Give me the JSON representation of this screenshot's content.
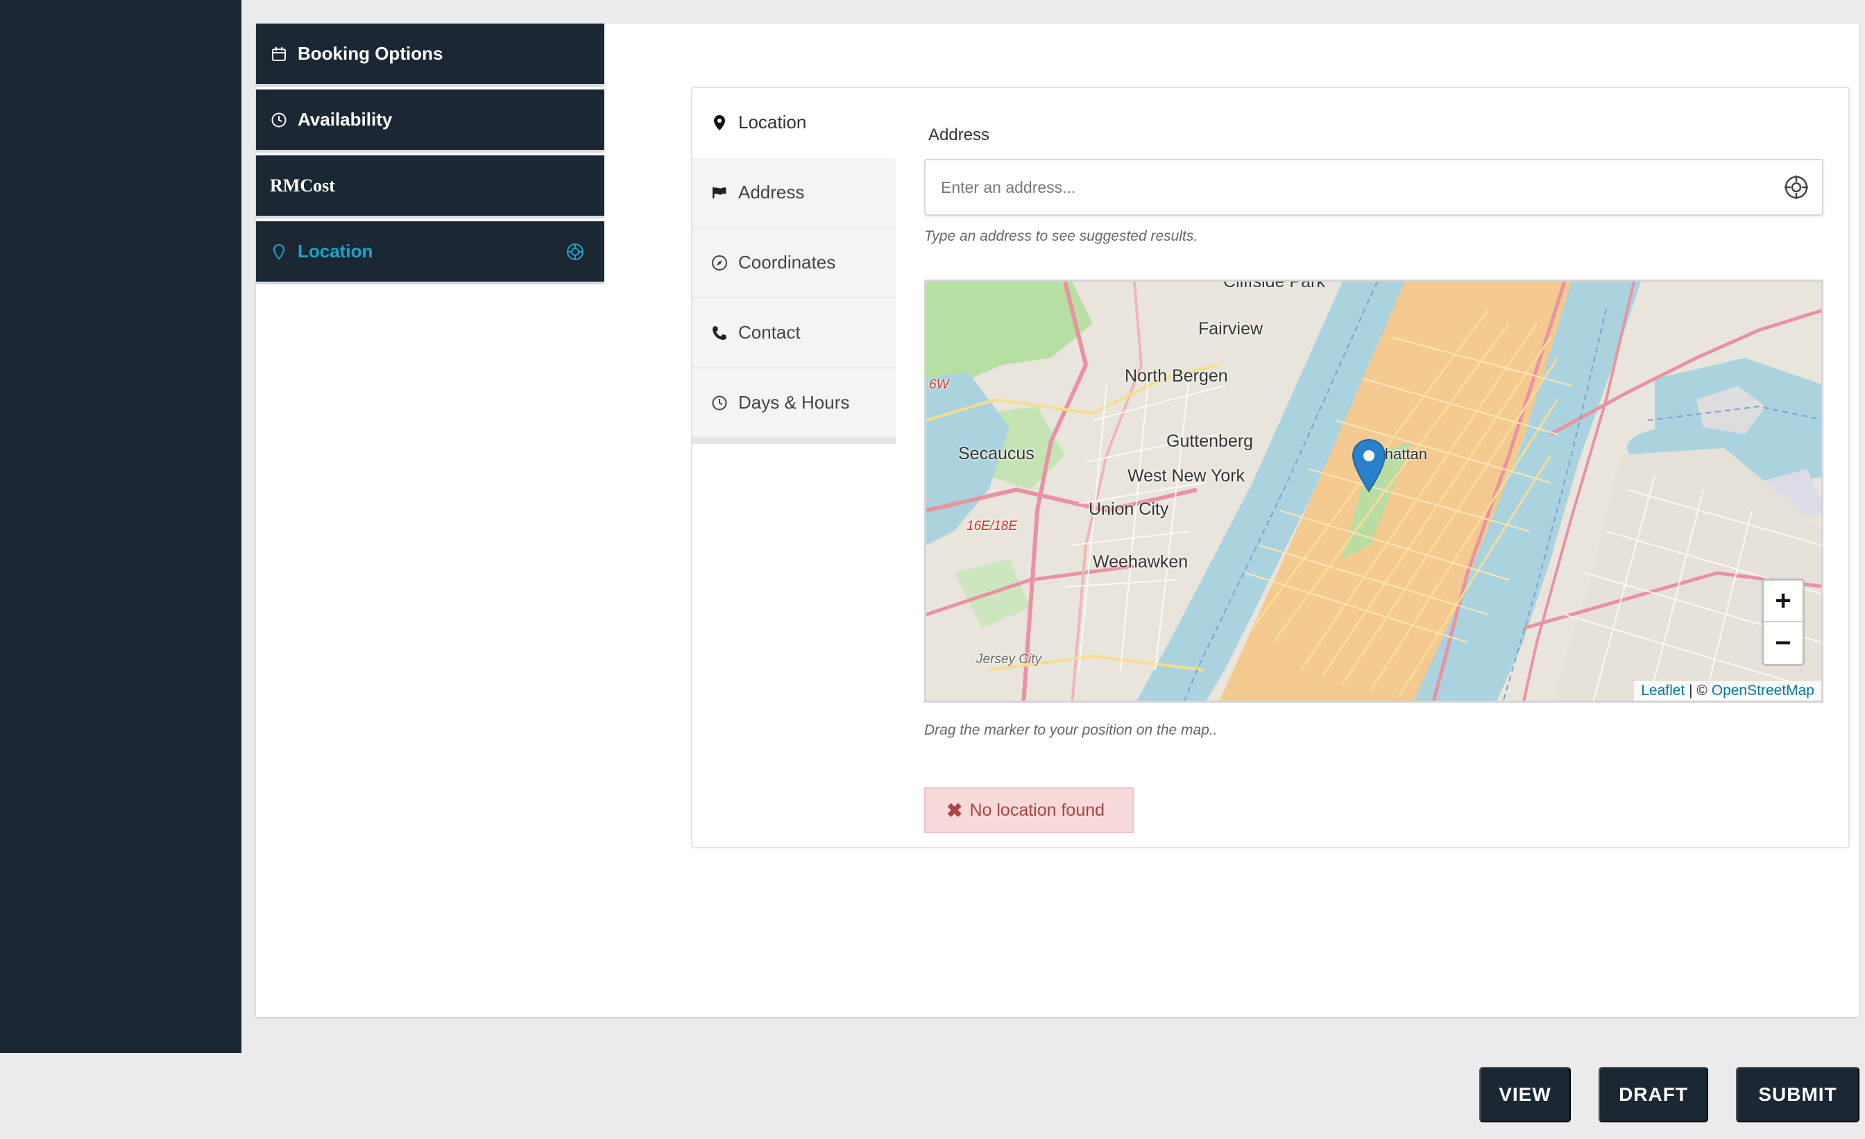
{
  "sidenav": {
    "items": [
      {
        "label": "Booking Options",
        "icon": "calendar-icon"
      },
      {
        "label": "Availability",
        "icon": "clock-icon"
      },
      {
        "label": "RMCost",
        "icon": ""
      },
      {
        "label": "Location",
        "icon": "map-pin-outline-icon",
        "trailing_icon": "crosshair-icon",
        "active": true
      }
    ]
  },
  "tabs": [
    {
      "label": "Location",
      "icon": "map-marker-icon",
      "active": true
    },
    {
      "label": "Address",
      "icon": "flag-icon"
    },
    {
      "label": "Coordinates",
      "icon": "compass-icon"
    },
    {
      "label": "Contact",
      "icon": "phone-icon"
    },
    {
      "label": "Days & Hours",
      "icon": "clock-icon"
    }
  ],
  "address": {
    "label": "Address",
    "placeholder": "Enter an address...",
    "value": "",
    "help": "Type an address to see suggested results."
  },
  "map": {
    "labels": {
      "cliffside": "Cliffside Park",
      "fairview": "Fairview",
      "north_bergen": "North Bergen",
      "secaucus": "Secaucus",
      "guttenberg": "Guttenberg",
      "west_new_york": "West New York",
      "union_city": "Union City",
      "weehawken": "Weehawken",
      "manhattan": "Manhattan",
      "jersey_city": "Jersey City",
      "route_a": "16E/18E",
      "route_b": "6W"
    },
    "zoom_in": "+",
    "zoom_out": "−",
    "attribution_leaflet": "Leaflet",
    "attribution_sep": " | © ",
    "attribution_osm": "OpenStreetMap",
    "help": "Drag the marker to your position on the map.."
  },
  "alert": {
    "icon": "✖",
    "text": "No location found"
  },
  "actions": {
    "view": "VIEW",
    "draft": "DRAFT",
    "submit": "SUBMIT"
  },
  "colors": {
    "navy": "#1b2834",
    "accent": "#1fa3c9",
    "alert_bg": "#f7d9da",
    "alert_text": "#a94442",
    "marker": "#2a81cb"
  }
}
